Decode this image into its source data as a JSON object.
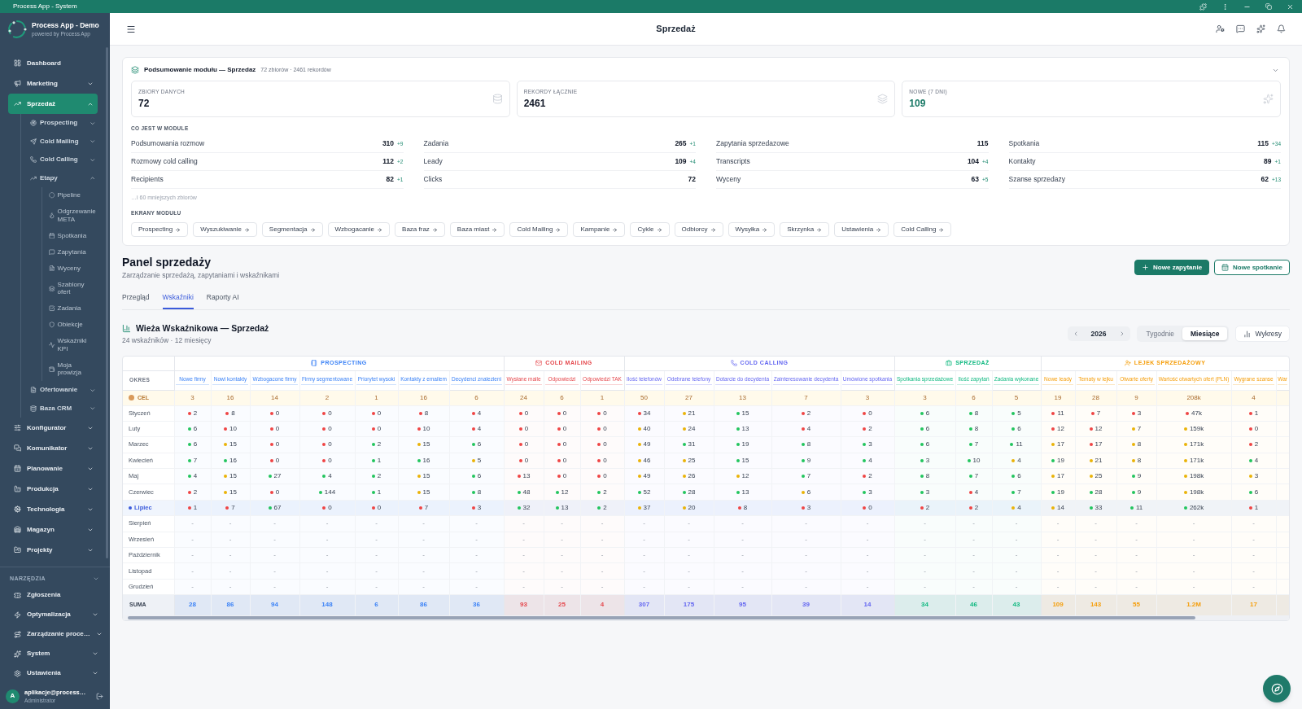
{
  "title_bar": {
    "title": "Process App - System"
  },
  "sidebar": {
    "brand": {
      "name": "Process App - Demo",
      "tagline": "powered by Process App"
    },
    "items": [
      {
        "label": "Dashboard",
        "selected": false
      },
      {
        "label": "Marketing",
        "selected": false,
        "expanded": false
      },
      {
        "label": "Sprzedaż",
        "selected": true,
        "expanded": true,
        "children": [
          {
            "label": "Prospecting",
            "selected": false,
            "expanded": false
          },
          {
            "label": "Cold Mailing",
            "selected": false,
            "expanded": false
          },
          {
            "label": "Cold Calling",
            "selected": false,
            "expanded": false
          },
          {
            "label": "Etapy",
            "selected": false,
            "expanded": true,
            "children": [
              {
                "label": "Pipeline",
                "selected": false
              },
              {
                "label": "Odgrzewanie META",
                "selected": false
              },
              {
                "label": "Spotkania",
                "selected": false
              },
              {
                "label": "Zapytania",
                "selected": false
              },
              {
                "label": "Wyceny",
                "selected": false
              },
              {
                "label": "Szablony ofert",
                "selected": false
              },
              {
                "label": "Zadania",
                "selected": false
              },
              {
                "label": "Obiekcje",
                "selected": false
              },
              {
                "label": "Wskaźniki KPI",
                "selected": false
              },
              {
                "label": "Moja prowizja",
                "selected": false
              }
            ]
          },
          {
            "label": "Ofertowanie",
            "selected": false,
            "expanded": false
          },
          {
            "label": "Baza CRM",
            "selected": false,
            "expanded": false
          }
        ]
      },
      {
        "label": "Konfigurator",
        "selected": false,
        "expanded": false
      },
      {
        "label": "Komunikator",
        "selected": false,
        "expanded": false
      },
      {
        "label": "Planowanie",
        "selected": false,
        "expanded": false
      },
      {
        "label": "Produkcja",
        "selected": false,
        "expanded": false
      },
      {
        "label": "Technologia",
        "selected": false,
        "expanded": false
      },
      {
        "label": "Magazyn",
        "selected": false,
        "expanded": false
      },
      {
        "label": "Projekty",
        "selected": false,
        "expanded": false
      }
    ],
    "tools_label": "NARZĘDZIA",
    "tools": [
      {
        "label": "Zgłoszenia",
        "selected": false
      },
      {
        "label": "Optymalizacja",
        "selected": false,
        "expanded": false
      },
      {
        "label": "Zarządzanie proce…",
        "selected": false,
        "expanded": false
      },
      {
        "label": "System",
        "selected": false,
        "expanded": false
      },
      {
        "label": "Ustawienia",
        "selected": false,
        "expanded": false
      }
    ],
    "user": {
      "initial": "A",
      "email": "aplikacje@process…",
      "role": "Administrator"
    }
  },
  "header": {
    "title": "Sprzedaż"
  },
  "summary": {
    "title": "Podsumowanie modułu — Sprzedaz",
    "meta": "72 zbiorów · 2461 rekordów",
    "stats": [
      {
        "kind": "count",
        "label": "ZBIORY DANYCH",
        "value": "72"
      },
      {
        "kind": "count",
        "label": "REKORDY ŁĄCZNIE",
        "value": "2461"
      },
      {
        "kind": "new",
        "label": "NOWE (7 DNI)",
        "value": "109"
      }
    ],
    "contents_label": "CO JEST W MODULE",
    "datasets": [
      {
        "name": "Podsumowania rozmow",
        "count": "310",
        "delta": "+9"
      },
      {
        "name": "Zadania",
        "count": "265",
        "delta": "+1"
      },
      {
        "name": "Zapytania sprzedazowe",
        "count": "115"
      },
      {
        "name": "Spotkania",
        "count": "115",
        "delta": "+34"
      },
      {
        "name": "Rozmowy cold calling",
        "count": "112",
        "delta": "+2"
      },
      {
        "name": "Leady",
        "count": "109",
        "delta": "+4"
      },
      {
        "name": "Transcripts",
        "count": "104",
        "delta": "+4"
      },
      {
        "name": "Kontakty",
        "count": "89",
        "delta": "+1"
      },
      {
        "name": "Recipients",
        "count": "82",
        "delta": "+1"
      },
      {
        "name": "Clicks",
        "count": "72"
      },
      {
        "name": "Wyceny",
        "count": "63",
        "delta": "+5"
      },
      {
        "name": "Szanse sprzedazy",
        "count": "62",
        "delta": "+13"
      }
    ],
    "more": "…i 60 mniejszych zbiorów",
    "screens_label": "EKRANY MODUŁU",
    "screens": [
      "Prospecting",
      "Wyszukiwanie",
      "Segmentacja",
      "Wzbogacanie",
      "Baza fraz",
      "Baza miast",
      "Cold Mailing",
      "Kampanie",
      "Cykle",
      "Odbiorcy",
      "Wysyłka",
      "Skrzynka",
      "Ustawienia",
      "Cold Calling"
    ]
  },
  "page": {
    "title": "Panel sprzedaży",
    "subtitle": "Zarządzanie sprzedażą, zapytaniami i wskaźnikami",
    "actions": [
      {
        "kind": "primary",
        "label": "Nowe zapytanie"
      },
      {
        "kind": "secondary",
        "label": "Nowe spotkanie"
      }
    ]
  },
  "tabs": [
    {
      "label": "Przegląd",
      "selected": false
    },
    {
      "label": "Wskaźniki",
      "selected": true
    },
    {
      "label": "Raporty AI",
      "selected": false
    }
  ],
  "kpi_tower": {
    "title": "Wieża Wskaźnikowa — Sprzedaż",
    "subtitle": "24 wskaźników · 12 miesięcy",
    "year": "2026",
    "granularity": [
      {
        "label": "Tygodnie",
        "selected": false
      },
      {
        "label": "Miesiące",
        "selected": true
      }
    ],
    "charts_button": "Wykresy",
    "table": {
      "period_header": "OKRES",
      "groups": [
        {
          "kind": "prospecting",
          "label": "PROSPECTING",
          "color": "#3b82f6",
          "columns": [
            "Nowe firmy",
            "Nowi kontakty",
            "Wzbogacone firmy",
            "Firmy segmentowane",
            "Priorytet wysoki",
            "Kontakty z emailem",
            "Decydenci znalezieni"
          ]
        },
        {
          "kind": "mailing",
          "label": "COLD MAILING",
          "color": "#e5484d",
          "columns": [
            "Wysłane maile",
            "Odpowiedzi",
            "Odpowiedzi TAK"
          ]
        },
        {
          "kind": "calling",
          "label": "COLD CALLING",
          "color": "#6366f1",
          "columns": [
            "Ilość telefonów",
            "Odebrane telefony",
            "Dotarcie do decydenta",
            "Zainteresowanie decydenta",
            "Umówione spotkania"
          ]
        },
        {
          "kind": "sales",
          "label": "SPRZEDAŻ",
          "color": "#10b981",
          "columns": [
            "Spotkania sprzedażowe",
            "Ilość zapytań",
            "Zadania wykonane"
          ]
        },
        {
          "kind": "funnel",
          "label": "LEJEK SPRZEDAŻOWY",
          "color": "#f59e0b",
          "columns": [
            "Nowe leady",
            "Tematy w lejku",
            "Otwarte oferty",
            "Wartość otwartych ofert (PLN)",
            "Wygrane szanse",
            "War"
          ]
        }
      ],
      "target_row": {
        "label": "CEL",
        "values": [
          "3",
          "16",
          "14",
          "2",
          "1",
          "16",
          "6",
          "24",
          "6",
          "1",
          "50",
          "27",
          "13",
          "7",
          "3",
          "3",
          "6",
          "5",
          "19",
          "28",
          "9",
          "208k",
          "4"
        ]
      },
      "rows": [
        {
          "label": "Styczeń",
          "current": false,
          "cells": [
            {
              "value": "2",
              "color": "#ef4444"
            },
            {
              "value": "8",
              "color": "#ef4444"
            },
            {
              "value": "0",
              "color": "#ef4444"
            },
            {
              "value": "0",
              "color": "#ef4444"
            },
            {
              "value": "0",
              "color": "#ef4444"
            },
            {
              "value": "8",
              "color": "#ef4444"
            },
            {
              "value": "4",
              "color": "#ef4444"
            },
            {
              "value": "0",
              "color": "#ef4444"
            },
            {
              "value": "0",
              "color": "#ef4444"
            },
            {
              "value": "0",
              "color": "#ef4444"
            },
            {
              "value": "34",
              "color": "#ef4444"
            },
            {
              "value": "21",
              "color": "#eab308"
            },
            {
              "value": "15",
              "color": "#22c55e"
            },
            {
              "value": "2",
              "color": "#ef4444"
            },
            {
              "value": "0",
              "color": "#ef4444"
            },
            {
              "value": "6",
              "color": "#22c55e"
            },
            {
              "value": "8",
              "color": "#22c55e"
            },
            {
              "value": "5",
              "color": "#22c55e"
            },
            {
              "value": "11",
              "color": "#ef4444"
            },
            {
              "value": "7",
              "color": "#ef4444"
            },
            {
              "value": "3",
              "color": "#ef4444"
            },
            {
              "value": "47k",
              "color": "#ef4444"
            },
            {
              "value": "1",
              "color": "#ef4444"
            }
          ]
        },
        {
          "label": "Luty",
          "current": false,
          "cells": [
            {
              "value": "6",
              "color": "#22c55e"
            },
            {
              "value": "10",
              "color": "#ef4444"
            },
            {
              "value": "0",
              "color": "#ef4444"
            },
            {
              "value": "0",
              "color": "#ef4444"
            },
            {
              "value": "0",
              "color": "#ef4444"
            },
            {
              "value": "10",
              "color": "#ef4444"
            },
            {
              "value": "4",
              "color": "#ef4444"
            },
            {
              "value": "0",
              "color": "#ef4444"
            },
            {
              "value": "0",
              "color": "#ef4444"
            },
            {
              "value": "0",
              "color": "#ef4444"
            },
            {
              "value": "40",
              "color": "#eab308"
            },
            {
              "value": "24",
              "color": "#eab308"
            },
            {
              "value": "13",
              "color": "#22c55e"
            },
            {
              "value": "4",
              "color": "#ef4444"
            },
            {
              "value": "2",
              "color": "#ef4444"
            },
            {
              "value": "6",
              "color": "#22c55e"
            },
            {
              "value": "8",
              "color": "#22c55e"
            },
            {
              "value": "6",
              "color": "#22c55e"
            },
            {
              "value": "12",
              "color": "#ef4444"
            },
            {
              "value": "12",
              "color": "#ef4444"
            },
            {
              "value": "7",
              "color": "#eab308"
            },
            {
              "value": "159k",
              "color": "#eab308"
            },
            {
              "value": "0",
              "color": "#ef4444"
            }
          ]
        },
        {
          "label": "Marzec",
          "current": false,
          "cells": [
            {
              "value": "6",
              "color": "#22c55e"
            },
            {
              "value": "15",
              "color": "#eab308"
            },
            {
              "value": "0",
              "color": "#ef4444"
            },
            {
              "value": "0",
              "color": "#ef4444"
            },
            {
              "value": "2",
              "color": "#22c55e"
            },
            {
              "value": "15",
              "color": "#eab308"
            },
            {
              "value": "6",
              "color": "#22c55e"
            },
            {
              "value": "0",
              "color": "#ef4444"
            },
            {
              "value": "0",
              "color": "#ef4444"
            },
            {
              "value": "0",
              "color": "#ef4444"
            },
            {
              "value": "49",
              "color": "#eab308"
            },
            {
              "value": "31",
              "color": "#22c55e"
            },
            {
              "value": "19",
              "color": "#22c55e"
            },
            {
              "value": "8",
              "color": "#22c55e"
            },
            {
              "value": "3",
              "color": "#22c55e"
            },
            {
              "value": "6",
              "color": "#22c55e"
            },
            {
              "value": "7",
              "color": "#22c55e"
            },
            {
              "value": "11",
              "color": "#22c55e"
            },
            {
              "value": "17",
              "color": "#eab308"
            },
            {
              "value": "17",
              "color": "#ef4444"
            },
            {
              "value": "8",
              "color": "#eab308"
            },
            {
              "value": "171k",
              "color": "#eab308"
            },
            {
              "value": "2",
              "color": "#ef4444"
            }
          ]
        },
        {
          "label": "Kwiecień",
          "current": false,
          "cells": [
            {
              "value": "7",
              "color": "#22c55e"
            },
            {
              "value": "16",
              "color": "#22c55e"
            },
            {
              "value": "0",
              "color": "#ef4444"
            },
            {
              "value": "0",
              "color": "#ef4444"
            },
            {
              "value": "1",
              "color": "#22c55e"
            },
            {
              "value": "16",
              "color": "#22c55e"
            },
            {
              "value": "5",
              "color": "#eab308"
            },
            {
              "value": "0",
              "color": "#ef4444"
            },
            {
              "value": "0",
              "color": "#ef4444"
            },
            {
              "value": "0",
              "color": "#ef4444"
            },
            {
              "value": "46",
              "color": "#eab308"
            },
            {
              "value": "25",
              "color": "#eab308"
            },
            {
              "value": "15",
              "color": "#22c55e"
            },
            {
              "value": "9",
              "color": "#22c55e"
            },
            {
              "value": "4",
              "color": "#22c55e"
            },
            {
              "value": "3",
              "color": "#22c55e"
            },
            {
              "value": "10",
              "color": "#22c55e"
            },
            {
              "value": "4",
              "color": "#eab308"
            },
            {
              "value": "19",
              "color": "#22c55e"
            },
            {
              "value": "21",
              "color": "#eab308"
            },
            {
              "value": "8",
              "color": "#eab308"
            },
            {
              "value": "171k",
              "color": "#eab308"
            },
            {
              "value": "4",
              "color": "#22c55e"
            }
          ]
        },
        {
          "label": "Maj",
          "current": false,
          "cells": [
            {
              "value": "4",
              "color": "#22c55e"
            },
            {
              "value": "15",
              "color": "#eab308"
            },
            {
              "value": "27",
              "color": "#22c55e"
            },
            {
              "value": "4",
              "color": "#22c55e"
            },
            {
              "value": "2",
              "color": "#22c55e"
            },
            {
              "value": "15",
              "color": "#eab308"
            },
            {
              "value": "6",
              "color": "#22c55e"
            },
            {
              "value": "13",
              "color": "#ef4444"
            },
            {
              "value": "0",
              "color": "#ef4444"
            },
            {
              "value": "0",
              "color": "#ef4444"
            },
            {
              "value": "49",
              "color": "#eab308"
            },
            {
              "value": "26",
              "color": "#eab308"
            },
            {
              "value": "12",
              "color": "#eab308"
            },
            {
              "value": "7",
              "color": "#22c55e"
            },
            {
              "value": "2",
              "color": "#ef4444"
            },
            {
              "value": "8",
              "color": "#22c55e"
            },
            {
              "value": "7",
              "color": "#22c55e"
            },
            {
              "value": "6",
              "color": "#22c55e"
            },
            {
              "value": "17",
              "color": "#eab308"
            },
            {
              "value": "25",
              "color": "#eab308"
            },
            {
              "value": "9",
              "color": "#22c55e"
            },
            {
              "value": "198k",
              "color": "#eab308"
            },
            {
              "value": "3",
              "color": "#eab308"
            }
          ]
        },
        {
          "label": "Czerwiec",
          "current": false,
          "cells": [
            {
              "value": "2",
              "color": "#ef4444"
            },
            {
              "value": "15",
              "color": "#eab308"
            },
            {
              "value": "0",
              "color": "#ef4444"
            },
            {
              "value": "144",
              "color": "#22c55e"
            },
            {
              "value": "1",
              "color": "#22c55e"
            },
            {
              "value": "15",
              "color": "#eab308"
            },
            {
              "value": "8",
              "color": "#22c55e"
            },
            {
              "value": "48",
              "color": "#22c55e"
            },
            {
              "value": "12",
              "color": "#22c55e"
            },
            {
              "value": "2",
              "color": "#22c55e"
            },
            {
              "value": "52",
              "color": "#22c55e"
            },
            {
              "value": "28",
              "color": "#22c55e"
            },
            {
              "value": "13",
              "color": "#22c55e"
            },
            {
              "value": "6",
              "color": "#eab308"
            },
            {
              "value": "3",
              "color": "#22c55e"
            },
            {
              "value": "3",
              "color": "#22c55e"
            },
            {
              "value": "4",
              "color": "#ef4444"
            },
            {
              "value": "7",
              "color": "#22c55e"
            },
            {
              "value": "19",
              "color": "#22c55e"
            },
            {
              "value": "28",
              "color": "#22c55e"
            },
            {
              "value": "9",
              "color": "#22c55e"
            },
            {
              "value": "198k",
              "color": "#eab308"
            },
            {
              "value": "6",
              "color": "#22c55e"
            }
          ]
        },
        {
          "label": "Lipiec",
          "current": true,
          "cells": [
            {
              "value": "1",
              "color": "#ef4444"
            },
            {
              "value": "7",
              "color": "#ef4444"
            },
            {
              "value": "67",
              "color": "#22c55e"
            },
            {
              "value": "0",
              "color": "#ef4444"
            },
            {
              "value": "0",
              "color": "#ef4444"
            },
            {
              "value": "7",
              "color": "#ef4444"
            },
            {
              "value": "3",
              "color": "#ef4444"
            },
            {
              "value": "32",
              "color": "#22c55e"
            },
            {
              "value": "13",
              "color": "#22c55e"
            },
            {
              "value": "2",
              "color": "#22c55e"
            },
            {
              "value": "37",
              "color": "#eab308"
            },
            {
              "value": "20",
              "color": "#eab308"
            },
            {
              "value": "8",
              "color": "#ef4444"
            },
            {
              "value": "3",
              "color": "#ef4444"
            },
            {
              "value": "0",
              "color": "#ef4444"
            },
            {
              "value": "2",
              "color": "#ef4444"
            },
            {
              "value": "2",
              "color": "#ef4444"
            },
            {
              "value": "4",
              "color": "#eab308"
            },
            {
              "value": "14",
              "color": "#eab308"
            },
            {
              "value": "33",
              "color": "#22c55e"
            },
            {
              "value": "11",
              "color": "#22c55e"
            },
            {
              "value": "262k",
              "color": "#22c55e"
            },
            {
              "value": "1",
              "color": "#ef4444"
            }
          ]
        },
        {
          "label": "Sierpień",
          "current": false,
          "cells": [
            {
              "value": "-"
            },
            {
              "value": "-"
            },
            {
              "value": "-"
            },
            {
              "value": "-"
            },
            {
              "value": "-"
            },
            {
              "value": "-"
            },
            {
              "value": "-"
            },
            {
              "value": "-"
            },
            {
              "value": "-"
            },
            {
              "value": "-"
            },
            {
              "value": "-"
            },
            {
              "value": "-"
            },
            {
              "value": "-"
            },
            {
              "value": "-"
            },
            {
              "value": "-"
            },
            {
              "value": "-"
            },
            {
              "value": "-"
            },
            {
              "value": "-"
            },
            {
              "value": "-"
            },
            {
              "value": "-"
            },
            {
              "value": "-"
            },
            {
              "value": "-"
            },
            {
              "value": "-"
            }
          ]
        },
        {
          "label": "Wrzesień",
          "current": false,
          "cells": [
            {
              "value": "-"
            },
            {
              "value": "-"
            },
            {
              "value": "-"
            },
            {
              "value": "-"
            },
            {
              "value": "-"
            },
            {
              "value": "-"
            },
            {
              "value": "-"
            },
            {
              "value": "-"
            },
            {
              "value": "-"
            },
            {
              "value": "-"
            },
            {
              "value": "-"
            },
            {
              "value": "-"
            },
            {
              "value": "-"
            },
            {
              "value": "-"
            },
            {
              "value": "-"
            },
            {
              "value": "-"
            },
            {
              "value": "-"
            },
            {
              "value": "-"
            },
            {
              "value": "-"
            },
            {
              "value": "-"
            },
            {
              "value": "-"
            },
            {
              "value": "-"
            },
            {
              "value": "-"
            }
          ]
        },
        {
          "label": "Październik",
          "current": false,
          "cells": [
            {
              "value": "-"
            },
            {
              "value": "-"
            },
            {
              "value": "-"
            },
            {
              "value": "-"
            },
            {
              "value": "-"
            },
            {
              "value": "-"
            },
            {
              "value": "-"
            },
            {
              "value": "-"
            },
            {
              "value": "-"
            },
            {
              "value": "-"
            },
            {
              "value": "-"
            },
            {
              "value": "-"
            },
            {
              "value": "-"
            },
            {
              "value": "-"
            },
            {
              "value": "-"
            },
            {
              "value": "-"
            },
            {
              "value": "-"
            },
            {
              "value": "-"
            },
            {
              "value": "-"
            },
            {
              "value": "-"
            },
            {
              "value": "-"
            },
            {
              "value": "-"
            },
            {
              "value": "-"
            }
          ]
        },
        {
          "label": "Listopad",
          "current": false,
          "cells": [
            {
              "value": "-"
            },
            {
              "value": "-"
            },
            {
              "value": "-"
            },
            {
              "value": "-"
            },
            {
              "value": "-"
            },
            {
              "value": "-"
            },
            {
              "value": "-"
            },
            {
              "value": "-"
            },
            {
              "value": "-"
            },
            {
              "value": "-"
            },
            {
              "value": "-"
            },
            {
              "value": "-"
            },
            {
              "value": "-"
            },
            {
              "value": "-"
            },
            {
              "value": "-"
            },
            {
              "value": "-"
            },
            {
              "value": "-"
            },
            {
              "value": "-"
            },
            {
              "value": "-"
            },
            {
              "value": "-"
            },
            {
              "value": "-"
            },
            {
              "value": "-"
            },
            {
              "value": "-"
            }
          ]
        },
        {
          "label": "Grudzień",
          "current": false,
          "cells": [
            {
              "value": "-"
            },
            {
              "value": "-"
            },
            {
              "value": "-"
            },
            {
              "value": "-"
            },
            {
              "value": "-"
            },
            {
              "value": "-"
            },
            {
              "value": "-"
            },
            {
              "value": "-"
            },
            {
              "value": "-"
            },
            {
              "value": "-"
            },
            {
              "value": "-"
            },
            {
              "value": "-"
            },
            {
              "value": "-"
            },
            {
              "value": "-"
            },
            {
              "value": "-"
            },
            {
              "value": "-"
            },
            {
              "value": "-"
            },
            {
              "value": "-"
            },
            {
              "value": "-"
            },
            {
              "value": "-"
            },
            {
              "value": "-"
            },
            {
              "value": "-"
            },
            {
              "value": "-"
            }
          ]
        }
      ],
      "total_row": {
        "label": "SUMA",
        "values": [
          "28",
          "86",
          "94",
          "148",
          "6",
          "86",
          "36",
          "93",
          "25",
          "4",
          "307",
          "175",
          "95",
          "39",
          "14",
          "34",
          "46",
          "43",
          "109",
          "143",
          "55",
          "1.2M",
          "17"
        ]
      }
    }
  }
}
